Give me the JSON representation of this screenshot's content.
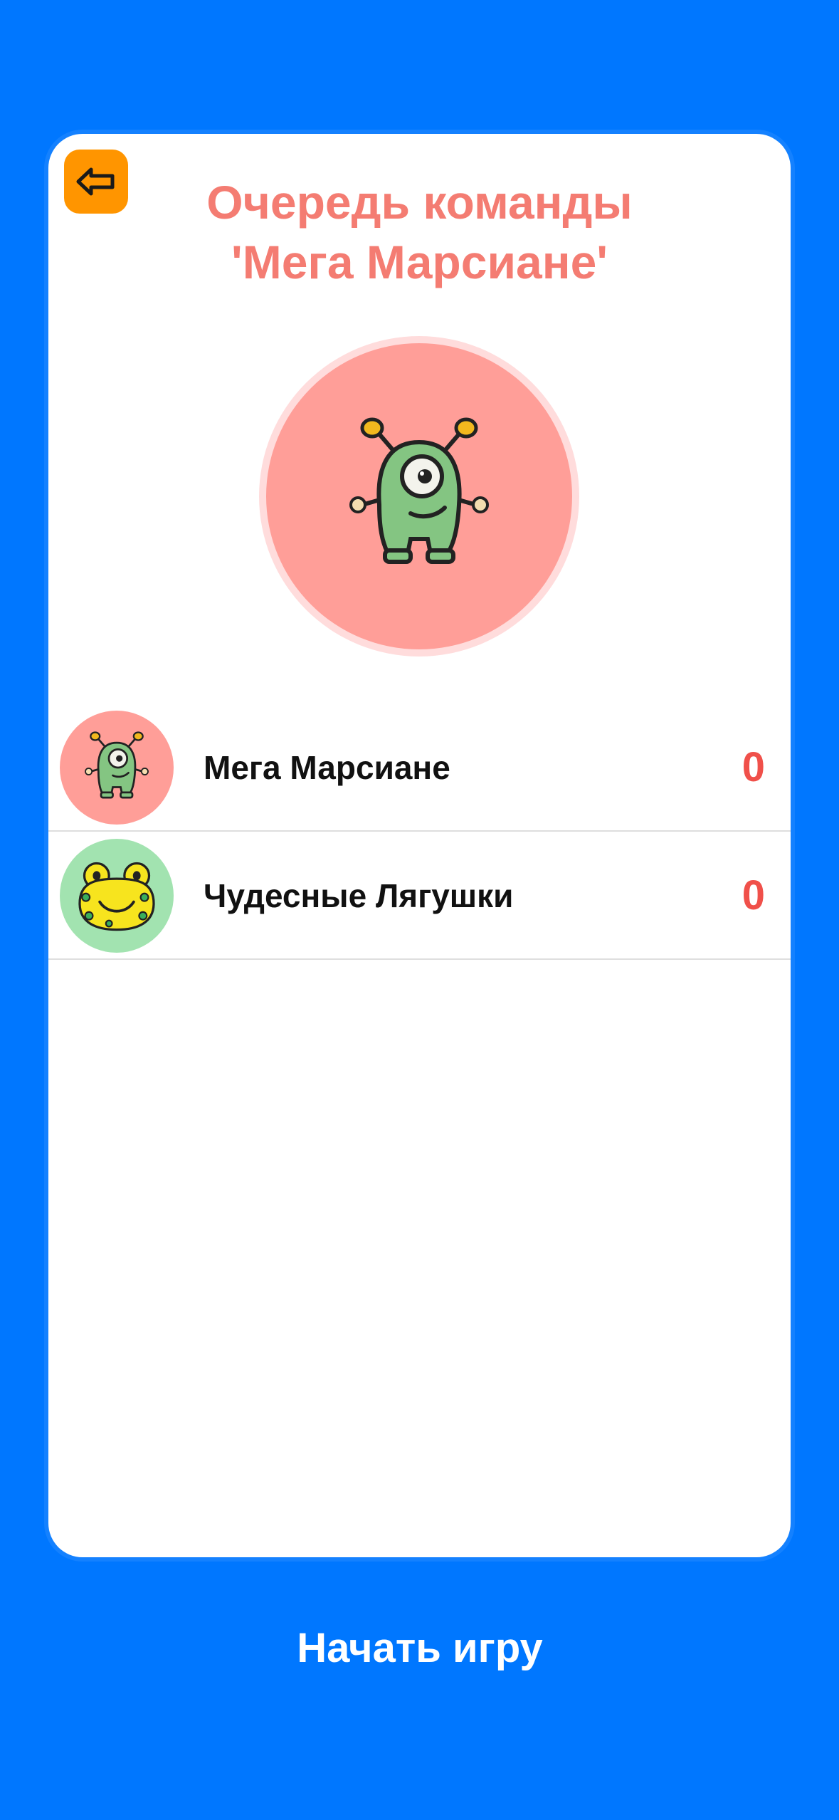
{
  "header": {
    "title_line1": "Очередь команды",
    "title_line2": "'Мега Марсиане'"
  },
  "current_team": {
    "avatar": "green-alien-monster",
    "avatar_bg": "#FF9E98"
  },
  "teams": [
    {
      "name": "Мега Марсиане",
      "score": "0",
      "avatar": "green-alien-monster",
      "avatar_bg": "#FF9E98"
    },
    {
      "name": "Чудесные Лягушки",
      "score": "0",
      "avatar": "yellow-frog",
      "avatar_bg": "#A2E3B0"
    }
  ],
  "footer": {
    "start_label": "Начать игру"
  },
  "colors": {
    "background": "#0077FF",
    "title": "#F47C72",
    "score": "#F0504A",
    "back_button": "#FF9500"
  },
  "icons": {
    "back": "arrow-left-icon"
  }
}
